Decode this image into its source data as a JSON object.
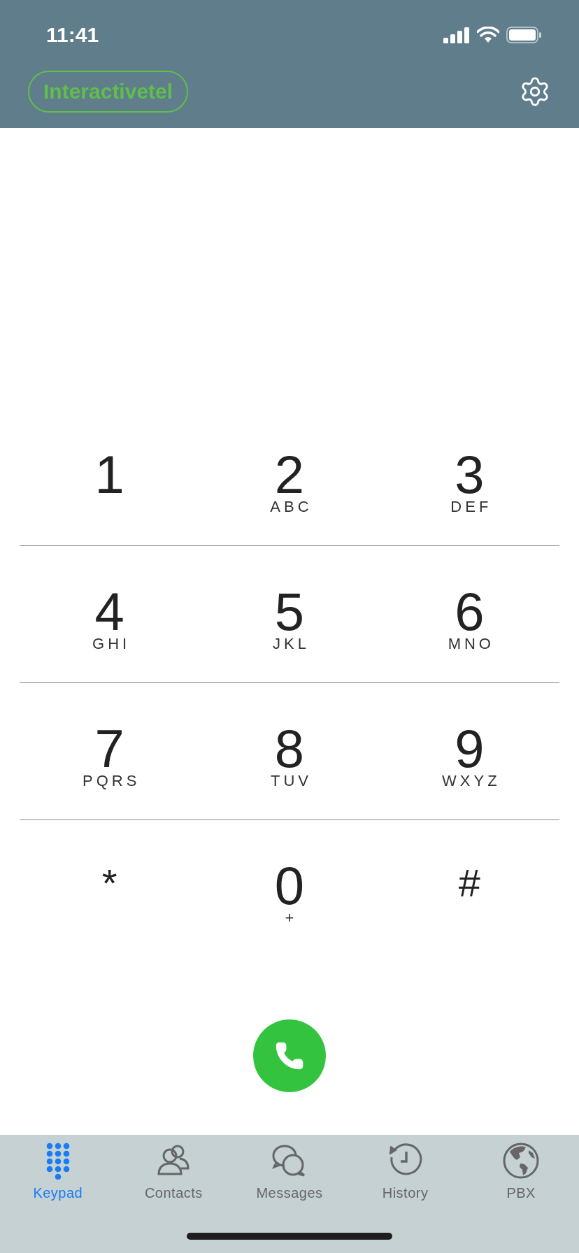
{
  "status_bar": {
    "time": "11:41"
  },
  "header": {
    "brand": "Interactivetel"
  },
  "keypad": [
    {
      "digit": "1"
    },
    {
      "digit": "2",
      "letters": "ABC"
    },
    {
      "digit": "3",
      "letters": "DEF"
    },
    {
      "digit": "4",
      "letters": "GHI"
    },
    {
      "digit": "5",
      "letters": "JKL"
    },
    {
      "digit": "6",
      "letters": "MNO"
    },
    {
      "digit": "7",
      "letters": "PQRS"
    },
    {
      "digit": "8",
      "letters": "TUV"
    },
    {
      "digit": "9",
      "letters": "WXYZ"
    },
    {
      "digit": "*",
      "kind": "symbol"
    },
    {
      "digit": "0",
      "letters": "+"
    },
    {
      "digit": "#",
      "kind": "symbol"
    }
  ],
  "tabs": [
    {
      "label": "Keypad",
      "kind": "keypad",
      "selected": true
    },
    {
      "label": "Contacts",
      "kind": "contacts",
      "selected": false
    },
    {
      "label": "Messages",
      "kind": "messages",
      "selected": false
    },
    {
      "label": "History",
      "kind": "history",
      "selected": false
    },
    {
      "label": "PBX",
      "kind": "pbx",
      "selected": false
    }
  ]
}
